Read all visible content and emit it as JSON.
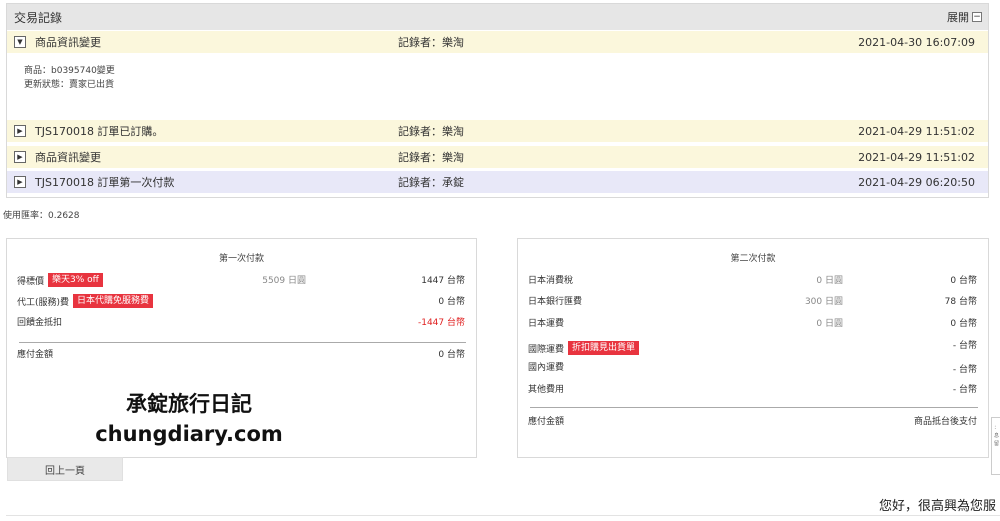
{
  "transactions": {
    "title": "交易記錄",
    "toggle_label": "展開",
    "toggle_icon": "−",
    "rows": [
      {
        "caret": "▼",
        "desc": "商品資訊變更",
        "recorder": "記錄者：樂淘",
        "time": "2021-04-30 16:07:09"
      },
      {
        "caret": "▶",
        "desc": "TJS170018 訂單已訂購。",
        "recorder": "記錄者：樂淘",
        "time": "2021-04-29 11:51:02"
      },
      {
        "caret": "▶",
        "desc": "商品資訊變更",
        "recorder": "記錄者：樂淘",
        "time": "2021-04-29 11:51:02"
      },
      {
        "caret": "▶",
        "desc": "TJS170018 訂單第一次付款",
        "recorder": "記錄者：承錠",
        "time": "2021-04-29 06:20:50"
      }
    ],
    "detail": {
      "line1": "商品：b0395740變更",
      "line2": "更新狀態：賣家已出貨"
    }
  },
  "exchange_rate": "使用匯率：0.2628",
  "first_payment": {
    "title": "第一次付款",
    "rows": [
      {
        "label": "得標價",
        "badge": "樂天3% off",
        "jpy": "5509 日圓",
        "twd": "1447 台幣"
      },
      {
        "label": "代工(服務)費",
        "badge": "日本代購免服務費",
        "jpy": "",
        "twd": "0 台幣"
      },
      {
        "label": "回饋金抵扣",
        "badge": "",
        "jpy": "",
        "twd": "-1447 台幣"
      }
    ],
    "total_label": "應付金額",
    "total_value": "0 台幣",
    "watermark_line1": "承錠旅行日記",
    "watermark_line2": "chungdiary.com"
  },
  "second_payment": {
    "title": "第二次付款",
    "rows": [
      {
        "label": "日本消費稅",
        "jpy": "0 日圓",
        "twd": "0 台幣"
      },
      {
        "label": "日本銀行匯費",
        "jpy": "300 日圓",
        "twd": "78 台幣"
      },
      {
        "label": "日本運費",
        "jpy": "0 日圓",
        "twd": "0 台幣"
      },
      {
        "label": "國際運費",
        "badge": "折扣購見出貨單",
        "jpy": "",
        "twd": "- 台幣"
      },
      {
        "label": "國內運費",
        "jpy": "",
        "twd": "- 台幣"
      },
      {
        "label": "其他費用",
        "jpy": "",
        "twd": "- 台幣"
      }
    ],
    "total_label": "應付金額",
    "total_value": "商品抵台後支付"
  },
  "back_button": "回上一頁",
  "chat_text": "您好，很高興為您服",
  "side_widget_glyphs": [
    "：",
    "息",
    "留"
  ],
  "colors": {
    "badge_red": "#e8343f",
    "negative_red": "#e02020",
    "row_yellow": "#fbf7dc",
    "row_blue": "#e8e8f8",
    "header_grey": "#e6e6e6"
  }
}
